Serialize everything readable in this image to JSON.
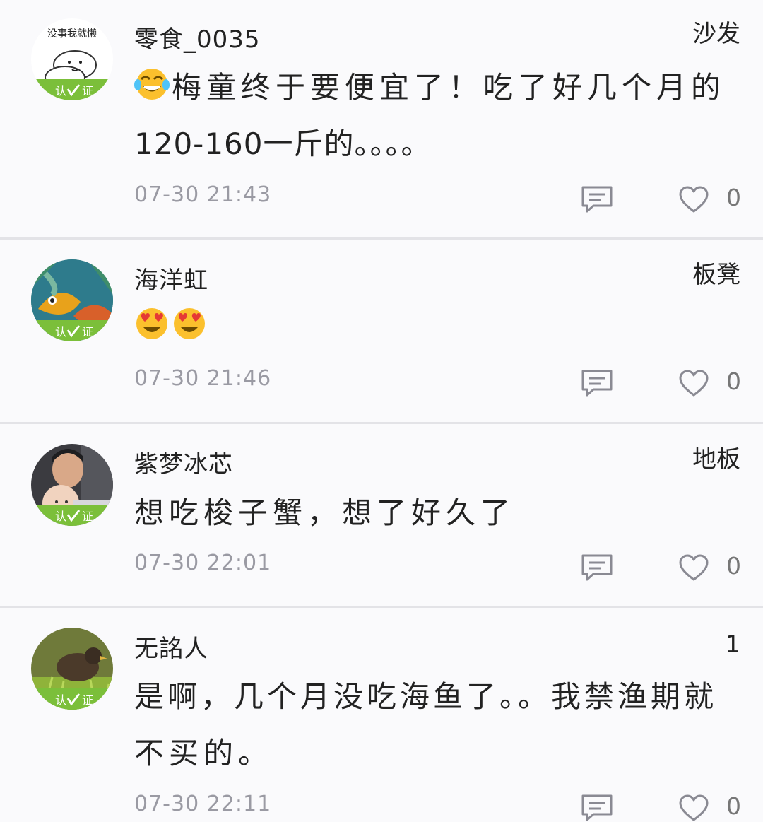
{
  "comments": [
    {
      "username": "零食_0035",
      "floor": "沙发",
      "content_line1": "梅童终于要便宜了！吃了好几个月的",
      "content_line2": "120-160一斤的。。。。",
      "time": "07-30 21:43",
      "likes": "0",
      "avatar_text": "没事我就懒",
      "emoji": "tears-of-joy",
      "verified_label_left": "认",
      "verified_label_right": "证"
    },
    {
      "username": "海洋虹",
      "floor": "板凳",
      "emoji": "heart-eyes",
      "emoji_count": 2,
      "time": "07-30 21:46",
      "likes": "0",
      "verified_label_left": "认",
      "verified_label_right": "证"
    },
    {
      "username": "紫梦冰芯",
      "floor": "地板",
      "content_line1": "想吃梭子蟹，想了好久了",
      "time": "07-30 22:01",
      "likes": "0",
      "verified_label_left": "认",
      "verified_label_right": "证"
    },
    {
      "username": "无詺人",
      "floor": "1",
      "content_line1": "是啊，几个月没吃海鱼了。。我禁渔期就",
      "content_line2": "不买的。",
      "time": "07-30 22:11",
      "likes": "0",
      "verified_label_left": "认",
      "verified_label_right": "证"
    }
  ],
  "colors": {
    "background": "#fafafc",
    "divider": "#e3e3e7",
    "verify_badge": "#7bbf3a",
    "timestamp": "#9a9aa3",
    "icon": "#8a8a93"
  },
  "icons": {
    "reply": "comment-bubble-icon",
    "like": "heart-outline-icon",
    "verify": "verified-check-icon"
  }
}
